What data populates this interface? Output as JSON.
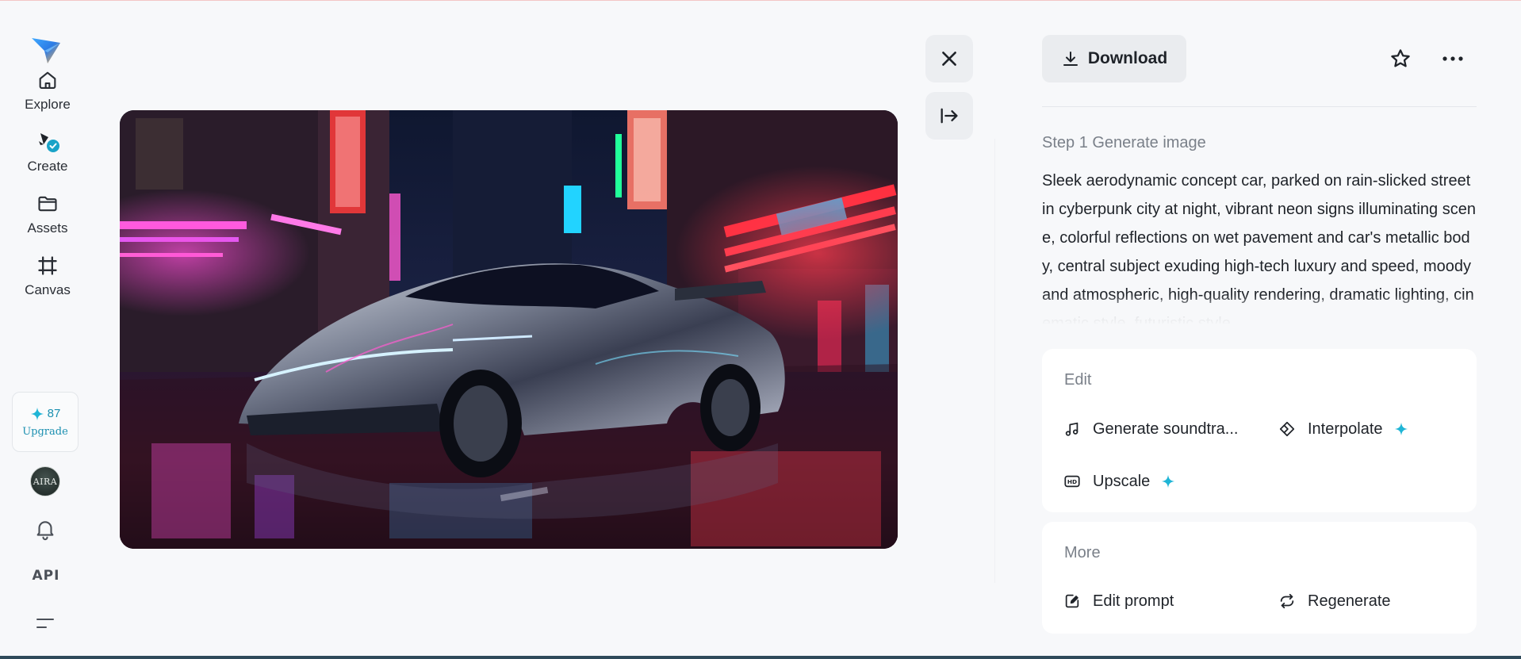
{
  "sidebar": {
    "nav": [
      {
        "label": "Explore",
        "icon": "home-icon"
      },
      {
        "label": "Create",
        "icon": "create-icon"
      },
      {
        "label": "Assets",
        "icon": "folder-icon"
      },
      {
        "label": "Canvas",
        "icon": "canvas-icon"
      }
    ],
    "credits": "87",
    "upgrade_label": "Upgrade",
    "avatar_text": "AIRA",
    "api_label": "API"
  },
  "panel": {
    "download_label": "Download",
    "step_title": "Step 1 Generate image",
    "prompt": "Sleek aerodynamic concept car, parked on rain-slicked street in cyberpunk city at night, vibrant neon signs illuminating scene, colorful reflections on wet pavement and car's metallic body, central subject exuding high-tech luxury and speed, moody and atmospheric, high-quality rendering, dramatic lighting, cinematic style, futuristic style",
    "edit": {
      "title": "Edit",
      "actions": [
        "Generate soundtra...",
        "Interpolate",
        "Upscale"
      ]
    },
    "more": {
      "title": "More",
      "actions": [
        "Edit prompt",
        "Regenerate"
      ]
    }
  },
  "colors": {
    "accent": "#1fb5d6",
    "background": "#f7f8fa",
    "card": "#ffffff"
  }
}
